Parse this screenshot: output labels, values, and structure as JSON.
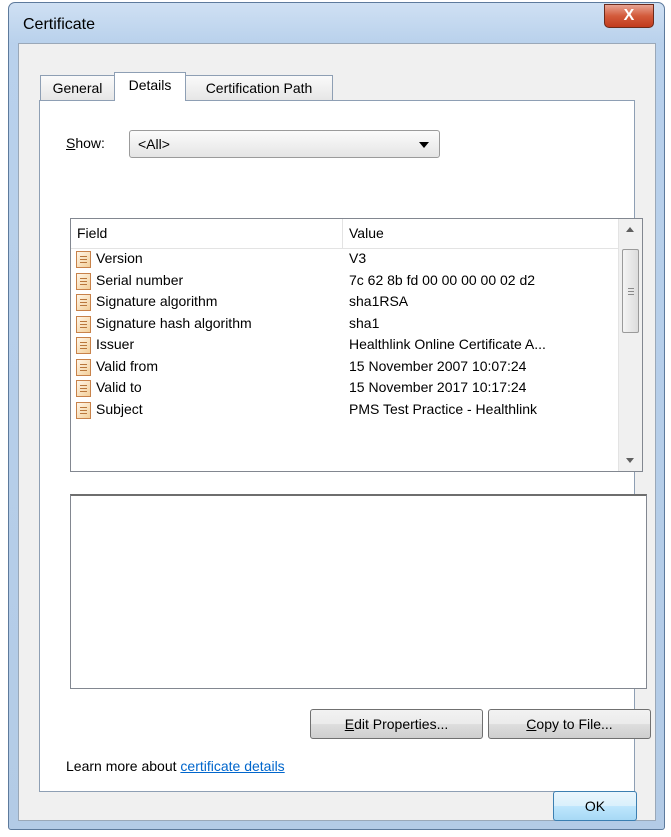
{
  "window": {
    "title": "Certificate",
    "close_glyph": "X",
    "close_icon": "close-icon"
  },
  "tabs": [
    {
      "label": "General",
      "active": false
    },
    {
      "label": "Details",
      "active": true
    },
    {
      "label": "Certification Path",
      "active": false
    }
  ],
  "show": {
    "label": "Show:",
    "mnemonic": "S",
    "label_rest": "how:",
    "selected": "<All>",
    "icon": "chevron-down-icon"
  },
  "list": {
    "columns": {
      "field": "Field",
      "value": "Value"
    },
    "rows": [
      {
        "field": "Version",
        "value": "V3"
      },
      {
        "field": "Serial number",
        "value": "7c 62 8b fd 00 00 00 00 02 d2"
      },
      {
        "field": "Signature algorithm",
        "value": "sha1RSA"
      },
      {
        "field": "Signature hash algorithm",
        "value": "sha1"
      },
      {
        "field": "Issuer",
        "value": "Healthlink Online Certificate A..."
      },
      {
        "field": "Valid from",
        "value": "15 November 2007 10:07:24"
      },
      {
        "field": "Valid to",
        "value": "15 November 2017 10:17:24"
      },
      {
        "field": "Subject",
        "value": "PMS Test Practice - Healthlink"
      }
    ],
    "row_icon": "certificate-field-icon"
  },
  "buttons": {
    "edit_mnemonic": "E",
    "edit_rest": "dit Properties...",
    "copy_mnemonic": "C",
    "copy_rest": "opy to File...",
    "ok": "OK"
  },
  "learn_more": {
    "prefix": "Learn more about ",
    "link": "certificate details"
  },
  "colors": {
    "link": "#0066cc",
    "close_button": "#c13b1d",
    "title_bar": "#b9d1ec"
  }
}
